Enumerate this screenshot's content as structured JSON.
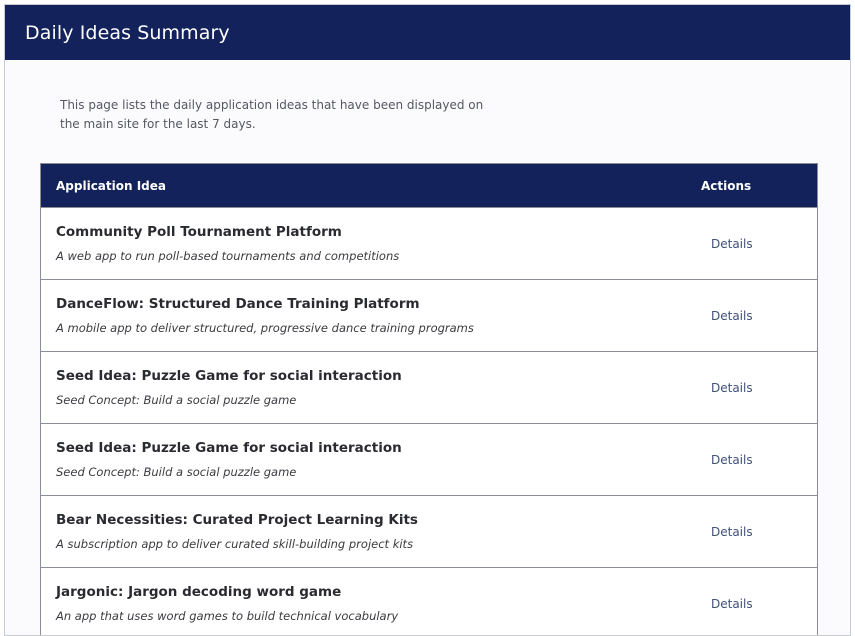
{
  "header": {
    "title": "Daily Ideas Summary"
  },
  "intro": {
    "text": "This page lists the daily application ideas that have been displayed on the main site for the last 7 days."
  },
  "table": {
    "columns": {
      "idea": "Application Idea",
      "actions": "Actions"
    },
    "rows": [
      {
        "title": "Community Poll Tournament Platform",
        "description": "A web app to run poll-based tournaments and competitions",
        "action": "Details"
      },
      {
        "title": "DanceFlow: Structured Dance Training Platform",
        "description": "A mobile app to deliver structured, progressive dance training programs",
        "action": "Details"
      },
      {
        "title": "Seed Idea: Puzzle Game for social interaction",
        "description": "Seed Concept: Build a social puzzle game",
        "action": "Details"
      },
      {
        "title": "Seed Idea: Puzzle Game for social interaction",
        "description": "Seed Concept: Build a social puzzle game",
        "action": "Details"
      },
      {
        "title": "Bear Necessities: Curated Project Learning Kits",
        "description": "A subscription app to deliver curated skill-building project kits",
        "action": "Details"
      },
      {
        "title": "Jargonic: Jargon decoding word game",
        "description": "An app that uses word games to build technical vocabulary",
        "action": "Details"
      }
    ]
  },
  "colors": {
    "header_bg": "#13225b",
    "link": "#3f4f7a"
  }
}
